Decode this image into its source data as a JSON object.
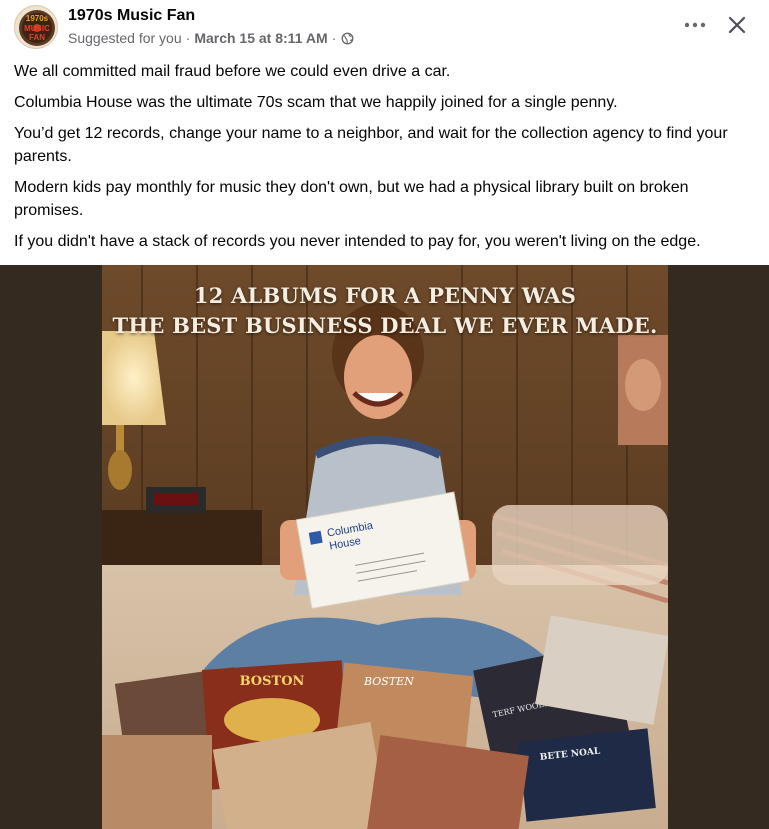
{
  "header": {
    "page_name": "1970s Music Fan",
    "suggested": "Suggested for you",
    "separator": "·",
    "date": "March 15 at 8:11 AM",
    "privacy_icon": "globe-icon",
    "more_icon": "more-horizontal-icon",
    "close_icon": "close-icon"
  },
  "avatar": {
    "line1": "1970s",
    "line2": "MUSIC",
    "line3": "FAN"
  },
  "post": {
    "paragraphs": [
      "We all committed mail fraud before we could even drive a car.",
      "Columbia House was the ultimate 70s scam that we happily joined for a single penny.",
      "You’d get 12 records, change your name to a neighbor, and wait for the collection agency to find your parents.",
      "Modern kids pay monthly for music they don't own, but we had a physical library built on broken promises.",
      "If you didn't have a stack of records you never intended to pay for, you weren't living on the edge."
    ]
  },
  "image": {
    "headline_line1": "12 ALBUMS FOR A PENNY WAS",
    "headline_line2": "THE BEST BUSINESS DEAL WE EVER MADE.",
    "envelope_line1": "Columbia",
    "envelope_line2": "House",
    "album_boston_1": "BOSTON",
    "album_boston_2": "BOSTEN",
    "album_bette": "BETE NOAL",
    "album_woole": "TERF WOOLS BANS"
  },
  "colors": {
    "text": "#050505",
    "meta": "#65676b",
    "image_bg": "#342a20"
  }
}
